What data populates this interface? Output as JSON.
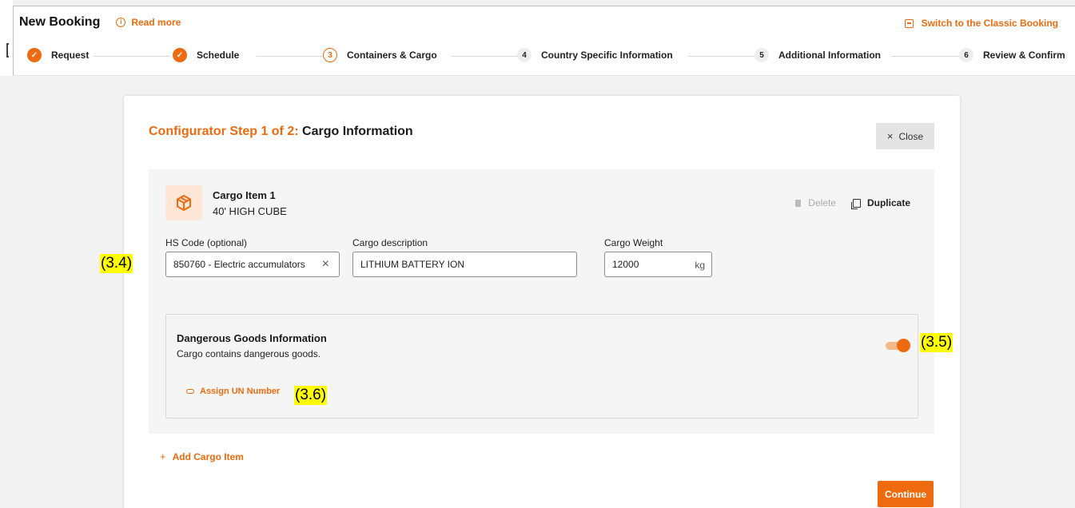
{
  "header": {
    "title": "New Booking",
    "read_more": "Read more",
    "classic_link": "Switch to the Classic Booking"
  },
  "steps": [
    {
      "num": "✓",
      "label": "Request",
      "state": "done"
    },
    {
      "num": "✓",
      "label": "Schedule",
      "state": "done"
    },
    {
      "num": "3",
      "label": "Containers & Cargo",
      "state": "active"
    },
    {
      "num": "4",
      "label": "Country Specific Information",
      "state": "todo"
    },
    {
      "num": "5",
      "label": "Additional Information",
      "state": "todo"
    },
    {
      "num": "6",
      "label": "Review & Confirm",
      "state": "todo"
    }
  ],
  "configurator": {
    "step_prefix": "Configurator Step 1 of 2:",
    "step_title": "Cargo Information",
    "close_label": "Close"
  },
  "cargo_item": {
    "title": "Cargo Item 1",
    "container": "40' HIGH CUBE",
    "delete_label": "Delete",
    "duplicate_label": "Duplicate",
    "hs_code": {
      "label": "HS Code (optional)",
      "value": "850760 - Electric accumulators"
    },
    "description": {
      "label": "Cargo description",
      "value": "LITHIUM BATTERY ION"
    },
    "weight": {
      "label": "Cargo Weight",
      "value": "12000",
      "unit": "kg"
    }
  },
  "dangerous_goods": {
    "title": "Dangerous Goods Information",
    "description": "Cargo contains dangerous goods.",
    "enabled": true,
    "assign_label": "Assign UN Number"
  },
  "add_item_label": "Add Cargo Item",
  "continue_label": "Continue",
  "annotations": {
    "a1": "(3.4)",
    "a2": "(3.5)",
    "a3": "(3.6)"
  },
  "colors": {
    "accent": "#ee6a0f",
    "highlight": "#ffff00"
  }
}
